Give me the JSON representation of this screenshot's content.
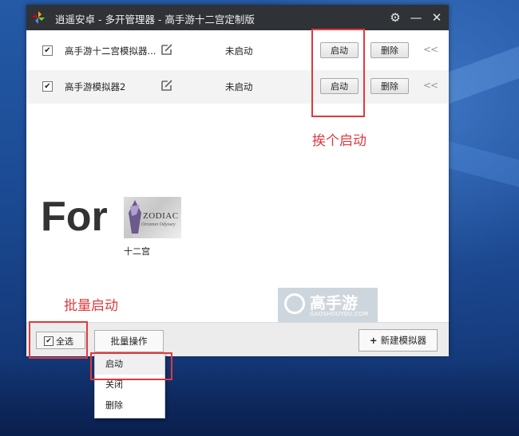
{
  "window": {
    "title": "逍遥安卓 - 多开管理器 - 高手游十二宫定制版",
    "controls": {
      "settings_icon": "gear-icon",
      "minimize_icon": "minimize-icon",
      "close_icon": "close-icon"
    }
  },
  "emulators": [
    {
      "checked": true,
      "name": "高手游十二宫模拟器...",
      "status": "未启动",
      "start_label": "启动",
      "delete_label": "删除",
      "more": "<<"
    },
    {
      "checked": true,
      "name": "高手游模拟器2",
      "status": "未启动",
      "start_label": "启动",
      "delete_label": "删除",
      "more": "<<"
    }
  ],
  "annotations": {
    "single_start": "挨个启动",
    "batch_start": "批量启动",
    "color": "#e0393e"
  },
  "promo": {
    "for_text": "For",
    "game_logo": "ZODIAC",
    "game_logo_sub": "Orcanon Odyssey",
    "game_caption": "十二宫"
  },
  "watermark": {
    "text": "高手游",
    "sub": "GAOSHOUYOU.COM"
  },
  "bottombar": {
    "select_all_checked": true,
    "select_all_label": "全选",
    "batch_label": "批量操作",
    "new_label": "新建模拟器",
    "new_icon": "plus-icon"
  },
  "batch_menu": [
    "启动",
    "关闭",
    "删除"
  ]
}
